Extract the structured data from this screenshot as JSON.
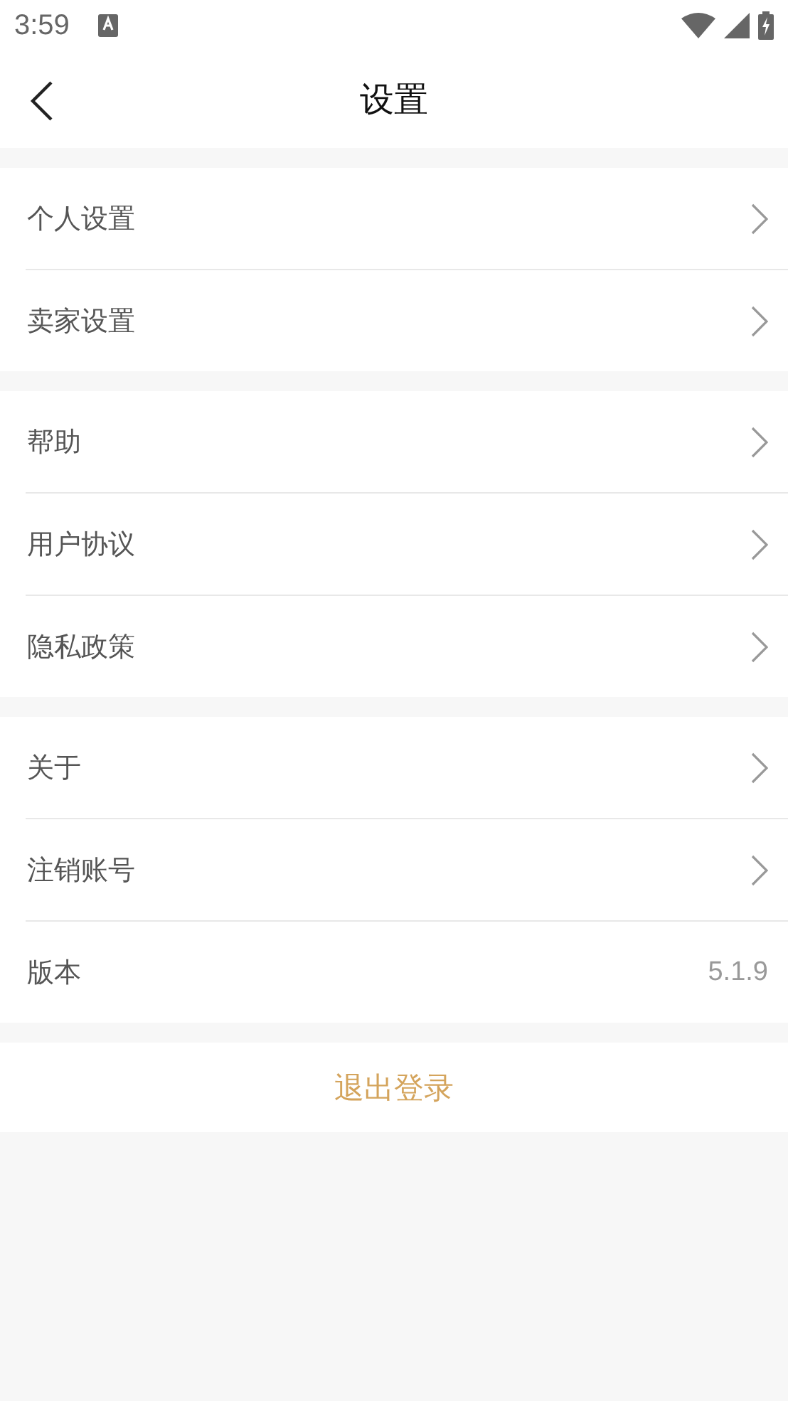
{
  "status_bar": {
    "time": "3:59"
  },
  "header": {
    "title": "设置"
  },
  "groups": [
    {
      "items": [
        {
          "kind": "link",
          "label": "个人设置"
        },
        {
          "kind": "link",
          "label": "卖家设置"
        }
      ]
    },
    {
      "items": [
        {
          "kind": "link",
          "label": "帮助"
        },
        {
          "kind": "link",
          "label": "用户协议"
        },
        {
          "kind": "link",
          "label": "隐私政策"
        }
      ]
    },
    {
      "items": [
        {
          "kind": "link",
          "label": "关于"
        },
        {
          "kind": "link",
          "label": "注销账号"
        },
        {
          "kind": "value",
          "label": "版本",
          "value": "5.1.9"
        }
      ]
    }
  ],
  "logout_button": {
    "label": "退出登录"
  }
}
